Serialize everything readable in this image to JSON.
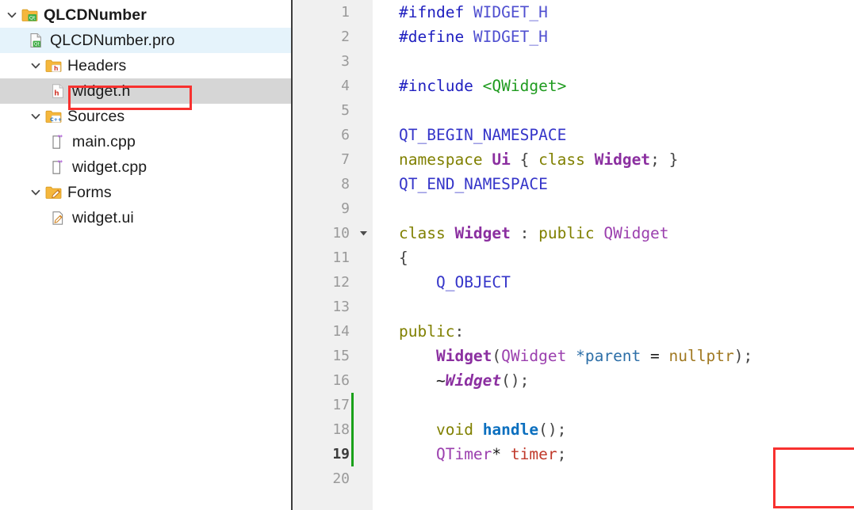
{
  "project_tree": {
    "items": [
      {
        "label": "QLCDNumber",
        "icon": "qt-folder-icon",
        "indent": 0,
        "expanded": true,
        "bold": true,
        "selected": "none",
        "highlighted": false
      },
      {
        "label": "QLCDNumber.pro",
        "icon": "qt-profile-file-icon",
        "indent": 1,
        "expanded": null,
        "bold": false,
        "selected": "blue",
        "highlighted": false
      },
      {
        "label": "Headers",
        "icon": "headers-folder-icon",
        "indent": 1,
        "expanded": true,
        "bold": false,
        "selected": "none",
        "highlighted": false
      },
      {
        "label": "widget.h",
        "icon": "header-file-icon",
        "indent": 2,
        "expanded": null,
        "bold": false,
        "selected": "gray",
        "highlighted": true
      },
      {
        "label": "Sources",
        "icon": "sources-folder-icon",
        "indent": 1,
        "expanded": true,
        "bold": false,
        "selected": "none",
        "highlighted": false
      },
      {
        "label": "main.cpp",
        "icon": "cpp-file-icon",
        "indent": 2,
        "expanded": null,
        "bold": false,
        "selected": "none",
        "highlighted": false
      },
      {
        "label": "widget.cpp",
        "icon": "cpp-file-icon",
        "indent": 2,
        "expanded": null,
        "bold": false,
        "selected": "none",
        "highlighted": false
      },
      {
        "label": "Forms",
        "icon": "forms-folder-icon",
        "indent": 1,
        "expanded": true,
        "bold": false,
        "selected": "none",
        "highlighted": false
      },
      {
        "label": "widget.ui",
        "icon": "ui-file-icon",
        "indent": 2,
        "expanded": null,
        "bold": false,
        "selected": "none",
        "highlighted": false
      }
    ]
  },
  "editor": {
    "filename": "widget.h",
    "current_line": 19,
    "fold_marker_line": 10,
    "changed_lines": [
      17,
      18,
      19
    ],
    "line_numbers": [
      "1",
      "2",
      "3",
      "4",
      "5",
      "6",
      "7",
      "8",
      "9",
      "10",
      "11",
      "12",
      "13",
      "14",
      "15",
      "16",
      "17",
      "18",
      "19",
      "20"
    ],
    "lines": [
      {
        "n": 1,
        "text": "#ifndef WIDGET_H"
      },
      {
        "n": 2,
        "text": "#define WIDGET_H"
      },
      {
        "n": 3,
        "text": ""
      },
      {
        "n": 4,
        "text": "#include <QWidget>"
      },
      {
        "n": 5,
        "text": ""
      },
      {
        "n": 6,
        "text": "QT_BEGIN_NAMESPACE"
      },
      {
        "n": 7,
        "text": "namespace Ui { class Widget; }"
      },
      {
        "n": 8,
        "text": "QT_END_NAMESPACE"
      },
      {
        "n": 9,
        "text": ""
      },
      {
        "n": 10,
        "text": "class Widget : public QWidget"
      },
      {
        "n": 11,
        "text": "{"
      },
      {
        "n": 12,
        "text": "    Q_OBJECT"
      },
      {
        "n": 13,
        "text": ""
      },
      {
        "n": 14,
        "text": "public:"
      },
      {
        "n": 15,
        "text": "    Widget(QWidget *parent = nullptr);"
      },
      {
        "n": 16,
        "text": "    ~Widget();"
      },
      {
        "n": 17,
        "text": ""
      },
      {
        "n": 18,
        "text": "    void handle();"
      },
      {
        "n": 19,
        "text": "    QTimer* timer;"
      },
      {
        "n": 20,
        "text": ""
      }
    ]
  },
  "annotations": {
    "boxes": [
      {
        "name": "widget-h-highlight",
        "color": "#f8312f",
        "target": "widget.h"
      },
      {
        "name": "new-members-highlight",
        "color": "#f8312f",
        "target": "void handle(); QTimer* timer;"
      }
    ]
  },
  "colors": {
    "annotation_red": "#f8312f",
    "selection_gray": "#d6d6d6",
    "selection_blue": "#e5f3fb",
    "gutter_bg": "#f0f0f0",
    "change_marker_green": "#1aa11a",
    "divider": "#3c3c3c"
  }
}
